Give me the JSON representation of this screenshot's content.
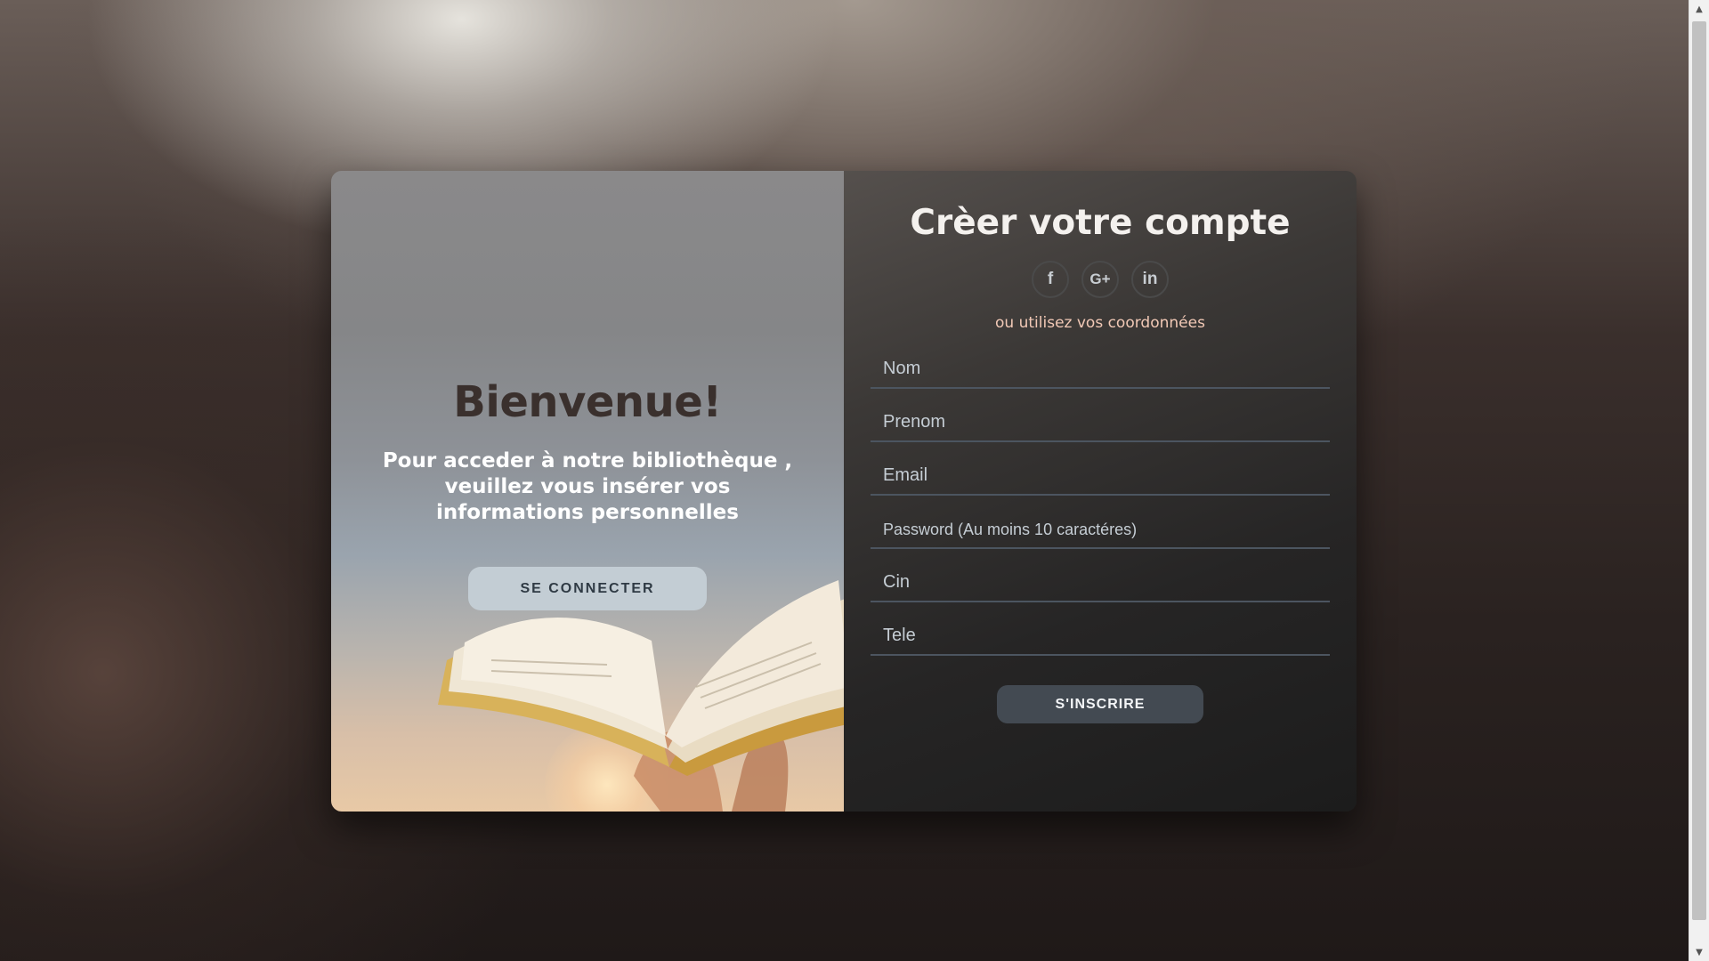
{
  "welcome": {
    "title": "Bienvenue!",
    "text": "Pour acceder à notre bibliothèque , veuillez vous insérer vos informations personnelles",
    "button_label": "SE CONNECTER"
  },
  "signup": {
    "title": "Crèer votre compte",
    "social": [
      {
        "icon": "facebook-icon",
        "glyph": "f"
      },
      {
        "icon": "google-plus-icon",
        "glyph": "G+"
      },
      {
        "icon": "linkedin-icon",
        "glyph": "in"
      }
    ],
    "or_text": "ou utilisez vos coordonnées",
    "fields": {
      "nom": {
        "placeholder": "Nom",
        "value": ""
      },
      "prenom": {
        "placeholder": "Prenom",
        "value": ""
      },
      "email": {
        "placeholder": "Email",
        "value": ""
      },
      "password": {
        "placeholder": "Password (Au moins 10 caractéres)",
        "value": ""
      },
      "cin": {
        "placeholder": "Cin",
        "value": ""
      },
      "tele": {
        "placeholder": "Tele",
        "value": ""
      }
    },
    "button_label": "S'INSCRIRE"
  },
  "colors": {
    "connect_button": "#c3cdd4",
    "signup_button": "#434a52",
    "accent_text": "#f2c9b6"
  }
}
